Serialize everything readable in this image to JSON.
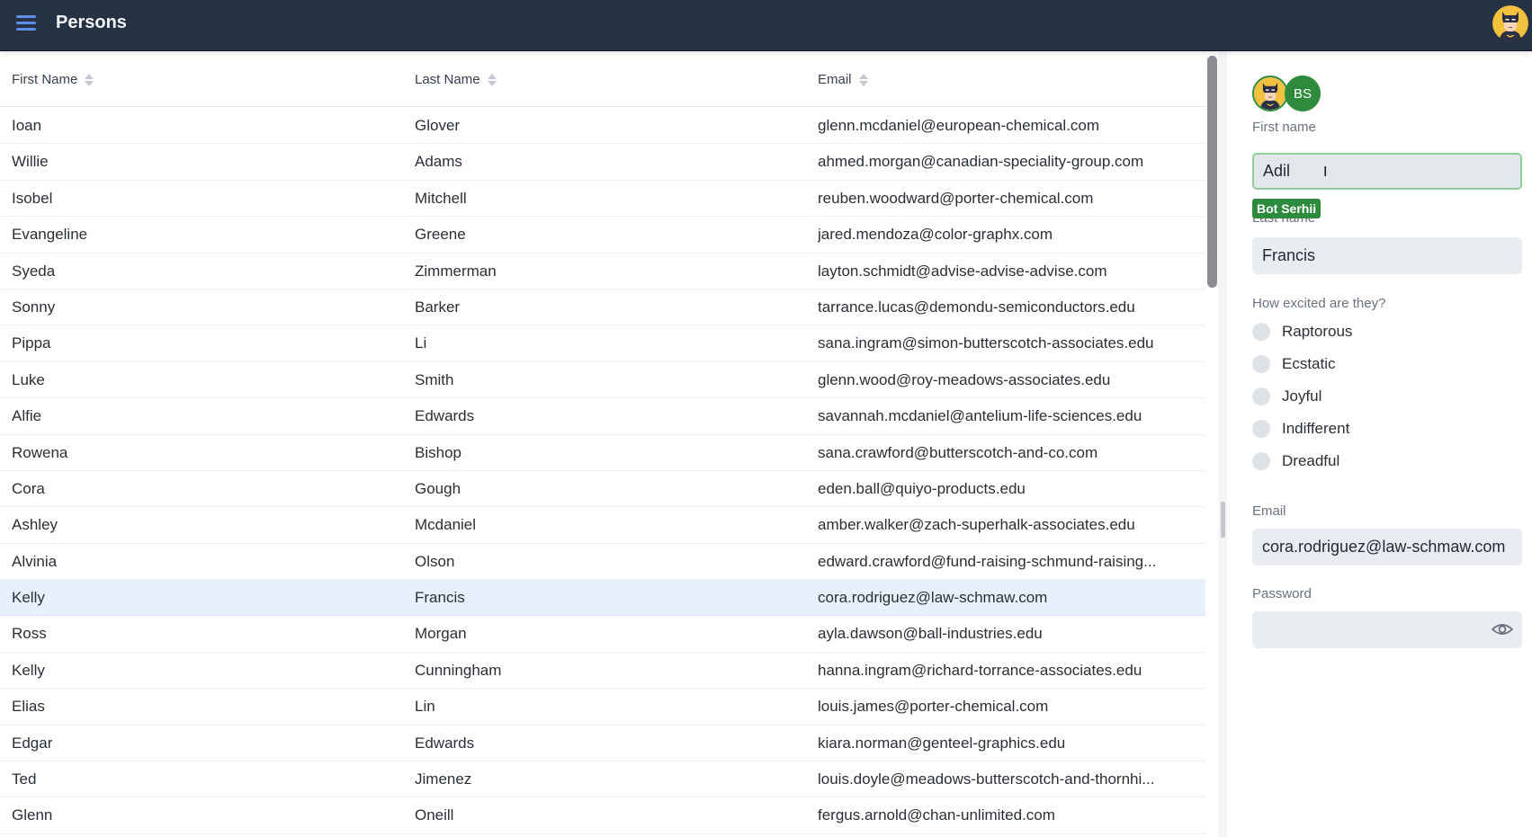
{
  "header": {
    "title": "Persons",
    "menu_icon": "hamburger-menu-icon",
    "user_avatar": "batman-avatar"
  },
  "table": {
    "columns": [
      {
        "label": "First Name",
        "sort_icon": "sort-icon"
      },
      {
        "label": "Last Name",
        "sort_icon": "sort-icon"
      },
      {
        "label": "Email",
        "sort_icon": "sort-icon"
      }
    ],
    "rows": [
      {
        "first": "Ioan",
        "last": "Glover",
        "email": "glenn.mcdaniel@european-chemical.com"
      },
      {
        "first": "Willie",
        "last": "Adams",
        "email": "ahmed.morgan@canadian-speciality-group.com"
      },
      {
        "first": "Isobel",
        "last": "Mitchell",
        "email": "reuben.woodward@porter-chemical.com"
      },
      {
        "first": "Evangeline",
        "last": "Greene",
        "email": "jared.mendoza@color-graphx.com"
      },
      {
        "first": "Syeda",
        "last": "Zimmerman",
        "email": "layton.schmidt@advise-advise-advise.com"
      },
      {
        "first": "Sonny",
        "last": "Barker",
        "email": "tarrance.lucas@demondu-semiconductors.edu"
      },
      {
        "first": "Pippa",
        "last": "Li",
        "email": "sana.ingram@simon-butterscotch-associates.edu"
      },
      {
        "first": "Luke",
        "last": "Smith",
        "email": "glenn.wood@roy-meadows-associates.edu"
      },
      {
        "first": "Alfie",
        "last": "Edwards",
        "email": "savannah.mcdaniel@antelium-life-sciences.edu"
      },
      {
        "first": "Rowena",
        "last": "Bishop",
        "email": "sana.crawford@butterscotch-and-co.com"
      },
      {
        "first": "Cora",
        "last": "Gough",
        "email": "eden.ball@quiyo-products.edu"
      },
      {
        "first": "Ashley",
        "last": "Mcdaniel",
        "email": "amber.walker@zach-superhalk-associates.edu"
      },
      {
        "first": "Alvinia",
        "last": "Olson",
        "email": "edward.crawford@fund-raising-schmund-raising..."
      },
      {
        "first": "Kelly",
        "last": "Francis",
        "email": "cora.rodriguez@law-schmaw.com",
        "selected": true
      },
      {
        "first": "Ross",
        "last": "Morgan",
        "email": "ayla.dawson@ball-industries.edu"
      },
      {
        "first": "Kelly",
        "last": "Cunningham",
        "email": "hanna.ingram@richard-torrance-associates.edu"
      },
      {
        "first": "Elias",
        "last": "Lin",
        "email": "louis.james@porter-chemical.com"
      },
      {
        "first": "Edgar",
        "last": "Edwards",
        "email": "kiara.norman@genteel-graphics.edu"
      },
      {
        "first": "Ted",
        "last": "Jimenez",
        "email": "louis.doyle@meadows-butterscotch-and-thornhi..."
      },
      {
        "first": "Glenn",
        "last": "Oneill",
        "email": "fergus.arnold@chan-unlimited.com"
      }
    ]
  },
  "panel": {
    "collaborators": [
      {
        "type": "image",
        "name": "batman-avatar"
      },
      {
        "type": "initials",
        "initials": "BS"
      }
    ],
    "presence_tag": "Bot Serhii",
    "first_name": {
      "label": "First name",
      "value": "Adil"
    },
    "last_name": {
      "label": "Last name",
      "value": "Francis"
    },
    "excitement": {
      "label": "How excited are they?",
      "options": [
        "Raptorous",
        "Ecstatic",
        "Joyful",
        "Indifferent",
        "Dreadful"
      ],
      "selected": null
    },
    "email": {
      "label": "Email",
      "value": "cora.rodriguez@law-schmaw.com"
    },
    "password": {
      "label": "Password",
      "value": "",
      "toggle_icon": "eye-icon"
    }
  },
  "colors": {
    "header_bg": "#263143",
    "accent_blue": "#5b8fe8",
    "presence_green": "#2e8b3e",
    "focus_border": "#8fcf98",
    "selected_row": "#e8f0fb"
  }
}
